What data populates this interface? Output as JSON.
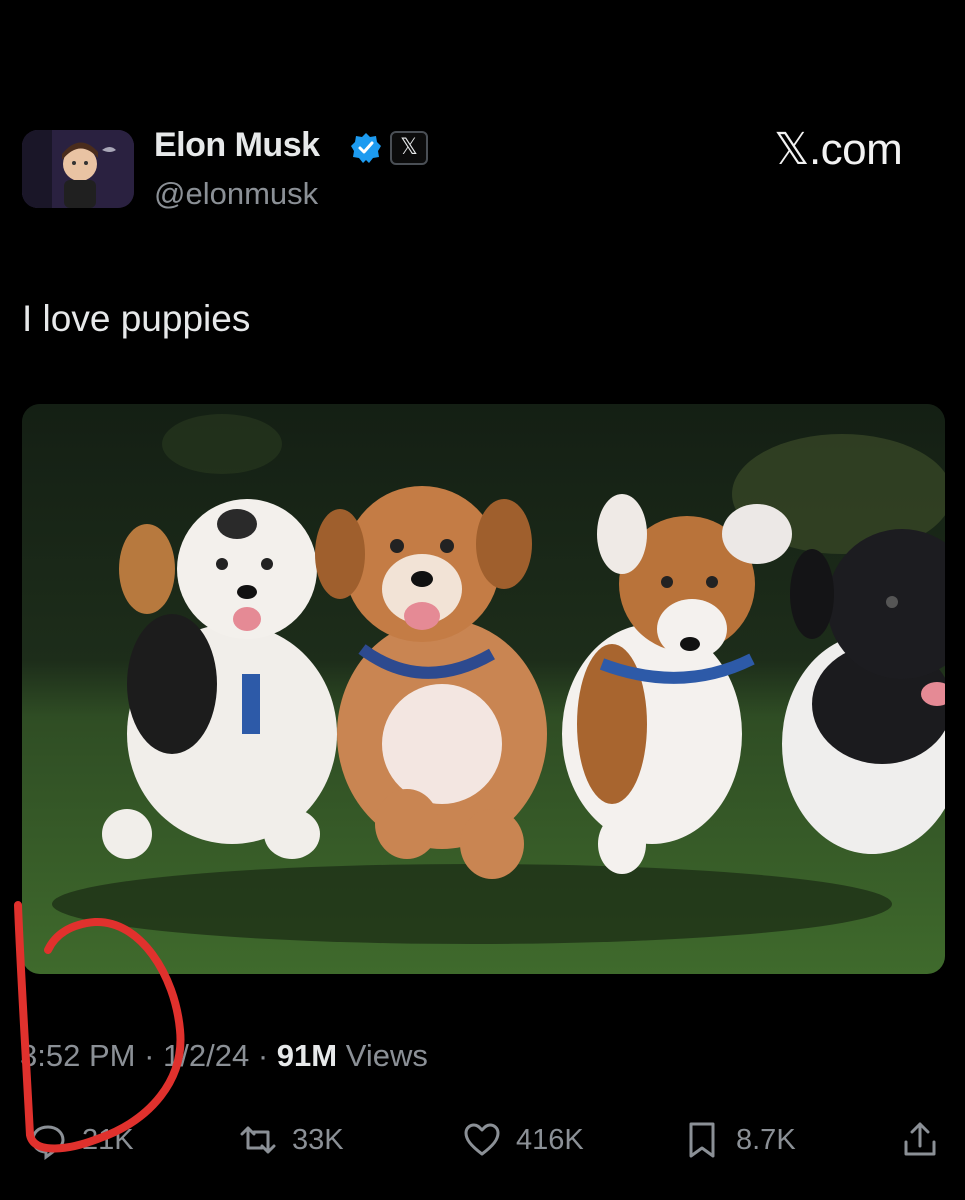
{
  "header": {
    "display_name": "Elon Musk",
    "handle": "@elonmusk",
    "verified_icon": "verified-badge-icon",
    "affiliation_badge": "𝕏",
    "brand": "𝕏.com"
  },
  "tweet": {
    "text": "I love puppies",
    "media_description": "four-puppies-running-image"
  },
  "meta": {
    "time": "3:52 PM",
    "separator1": " · ",
    "date": "1/2/24",
    "separator2": " · ",
    "views_count": "91M",
    "views_label": " Views"
  },
  "actions": {
    "replies": "21K",
    "reposts": "33K",
    "likes": "416K",
    "bookmarks": "8.7K"
  },
  "colors": {
    "background": "#000000",
    "verified_blue": "#1d9bf0",
    "annotation_red": "#e0312d",
    "muted_text": "#8b9096"
  }
}
